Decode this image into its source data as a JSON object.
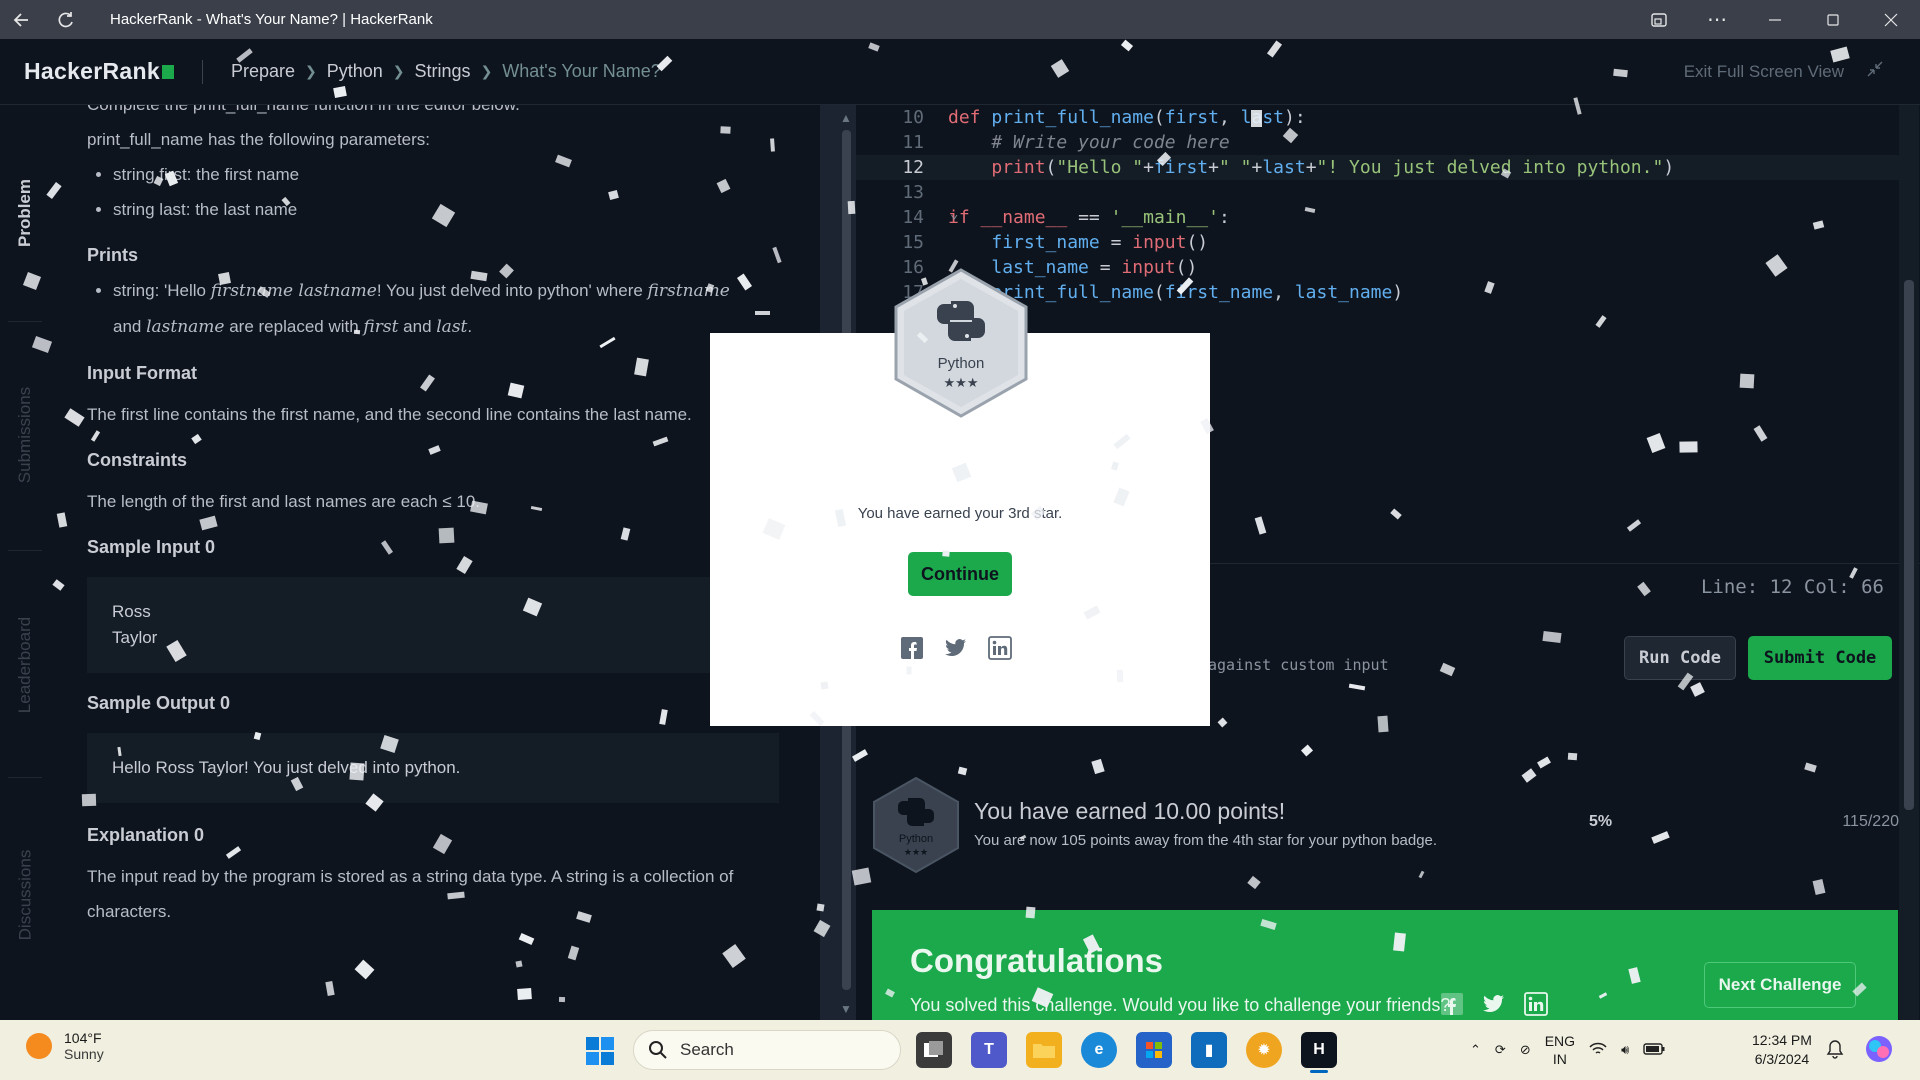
{
  "browser": {
    "title": "HackerRank - What's Your Name? | HackerRank"
  },
  "header": {
    "logo": "HackerRank",
    "breadcrumbs": [
      "Prepare",
      "Python",
      "Strings",
      "What's Your Name?"
    ],
    "exit_fullscreen": "Exit Full Screen View"
  },
  "vtabs": [
    "Problem",
    "Submissions",
    "Leaderboard",
    "Discussions"
  ],
  "problem": {
    "intro": "Complete the print_full_name function in the editor below.",
    "params_title": "print_full_name has the following parameters:",
    "params": [
      "string first: the first name",
      "string last: the last name"
    ],
    "prints_heading": "Prints",
    "prints_pre": "string: 'Hello ",
    "prints_var1": "firstname lastname",
    "prints_mid": "! You just delved into python' where ",
    "prints_var2": "firstname",
    "prints_and": "and ",
    "prints_var3": "lastname",
    "prints_replaced": " are replaced with ",
    "prints_var4": "first",
    "prints_and2": " and ",
    "prints_var5": "last",
    "prints_end": ".",
    "input_heading": "Input Format",
    "input_text": "The first line contains the first name, and the second line contains the last name.",
    "constraints_heading": "Constraints",
    "constraints_text": "The length of the first and last names are each ≤ 10.",
    "sample_input_heading": "Sample Input 0",
    "sample_input": [
      "Ross",
      "Taylor"
    ],
    "sample_output_heading": "Sample Output 0",
    "sample_output": "Hello Ross Taylor! You just delved into python.",
    "explanation_heading": "Explanation 0",
    "explanation_text": "The input read by the program is stored as a string data type. A string is a collection of characters."
  },
  "editor": {
    "line_numbers": [
      "10",
      "11",
      "12",
      "13",
      "14",
      "15",
      "16",
      "17"
    ],
    "status": "Line: 12 Col: 66",
    "custom_input": "against custom input",
    "run_label": "Run Code",
    "submit_label": "Submit Code"
  },
  "points": {
    "earned": "You have earned 10.00 points!",
    "away": "You are now 105 points away from the 4th star for your python badge.",
    "percent": "5%",
    "fraction": "115/220",
    "badge_label": "Python",
    "badge_stars": "★★★"
  },
  "congrats": {
    "title": "Congratulations",
    "subtitle": "You solved this challenge. Would you like to challenge your friends?",
    "next_label": "Next Challenge"
  },
  "modal": {
    "badge_label": "Python",
    "badge_stars": "★★★",
    "message": "You have earned your 3rd star.",
    "continue_label": "Continue"
  },
  "taskbar": {
    "temp": "104°F",
    "condition": "Sunny",
    "search_label": "Search",
    "lang_top": "ENG",
    "lang_bottom": "IN",
    "time": "12:34 PM",
    "date": "6/3/2024"
  },
  "colors": {
    "brand_green": "#1ba94c",
    "background": "#0e141e"
  }
}
